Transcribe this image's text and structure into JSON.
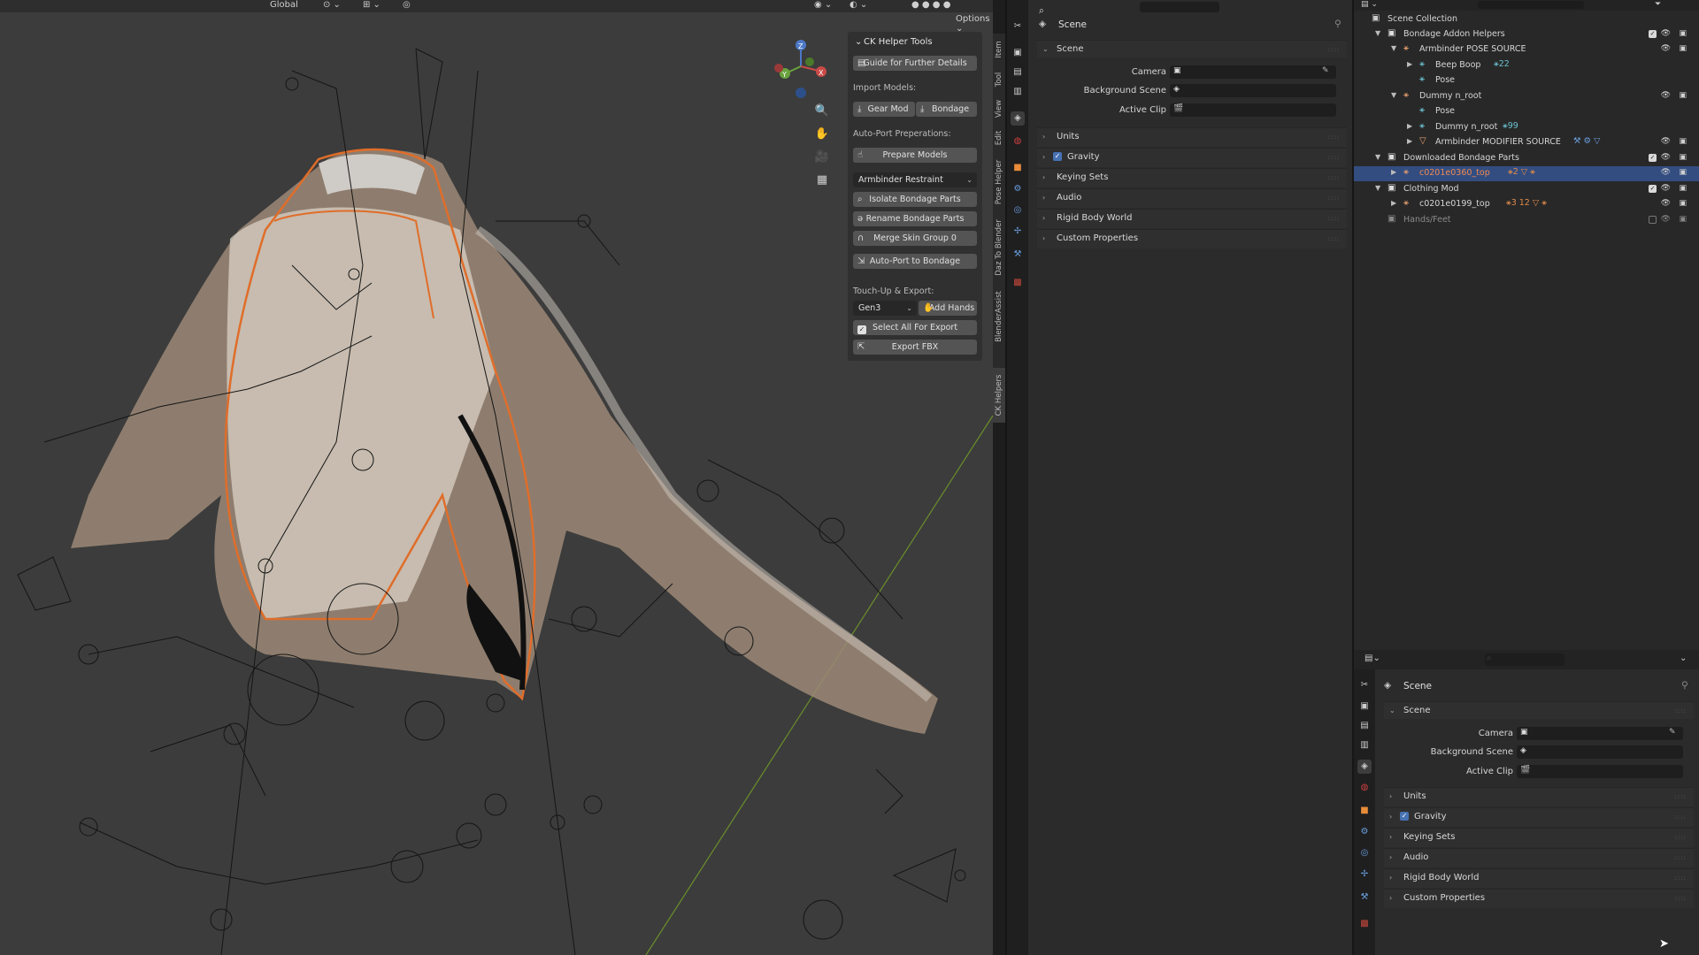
{
  "viewport_header": {
    "transform": "Global",
    "options": "Options"
  },
  "ck_panel": {
    "title": "CK Helper Tools",
    "guide": "Guide for Further Details",
    "import_label": "Import Models:",
    "gear_mod": "Gear Mod",
    "bondage": "Bondage",
    "autoport_label": "Auto-Port Preperations:",
    "prepare": "Prepare Models",
    "restraint_select": "Armbinder Restraint",
    "isolate": "Isolate Bondage Parts",
    "rename": "Rename Bondage Parts",
    "merge": "Merge Skin Group 0",
    "autoport_btn": "Auto-Port to Bondage",
    "touchup_label": "Touch-Up & Export:",
    "gen_select": "Gen3",
    "add_hands": "Add Hands",
    "select_all": "Select All For Export",
    "export_fbx": "Export FBX"
  },
  "vertical_tabs": [
    "Item",
    "Tool",
    "View",
    "Edit",
    "Pose Helper",
    "Daz To Blender",
    "BlenderAssist",
    "CK Helpers"
  ],
  "properties": {
    "header": "Scene",
    "section": "Scene",
    "camera_label": "Camera",
    "background_label": "Background Scene",
    "clip_label": "Active Clip",
    "units": "Units",
    "gravity": "Gravity",
    "keying": "Keying Sets",
    "audio": "Audio",
    "rigid": "Rigid Body World",
    "custom": "Custom Properties"
  },
  "outliner": {
    "root": "Scene Collection",
    "rows": [
      {
        "label": "Bondage Addon Helpers"
      },
      {
        "label": "Armbinder POSE SOURCE"
      },
      {
        "label": "Beep Boop",
        "extra": "22"
      },
      {
        "label": "Pose"
      },
      {
        "label": "Dummy n_root"
      },
      {
        "label": "Pose"
      },
      {
        "label": "Dummy n_root",
        "extra": "99"
      },
      {
        "label": "Armbinder MODIFIER SOURCE"
      },
      {
        "label": "Downloaded Bondage Parts"
      },
      {
        "label": "c0201e0360_top",
        "extra": "2"
      },
      {
        "label": "Clothing Mod"
      },
      {
        "label": "c0201e0199_top",
        "extra": "3 12"
      },
      {
        "label": "Hands/Feet"
      }
    ]
  },
  "colors": {
    "accent": "#4772b3",
    "selection": "#e06d2a",
    "panel": "#303030",
    "viewport": "#3c3c3c"
  }
}
